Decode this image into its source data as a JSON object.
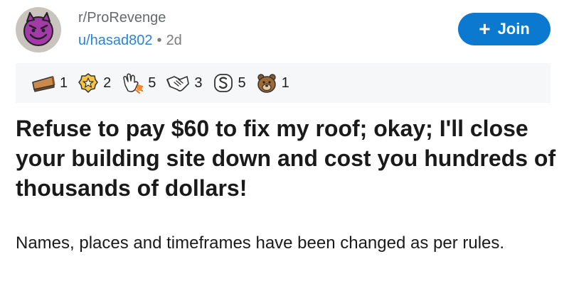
{
  "post": {
    "subreddit": "r/ProRevenge",
    "username": "u/hasad802",
    "separator": "•",
    "age": "2d",
    "join_label": "Join",
    "join_icon": "plus-icon",
    "title": "Refuse to pay $60 to fix my roof; okay; I'll close your building site down and cost you hundreds of thousands of dollars!",
    "body": "Names, places and timeframes have been changed as per rules."
  },
  "awards": [
    {
      "icon": "pie-slice-icon",
      "count": "1"
    },
    {
      "icon": "star-badge-icon",
      "count": "2"
    },
    {
      "icon": "clapping-hand-icon",
      "count": "5"
    },
    {
      "icon": "handshake-icon",
      "count": "3"
    },
    {
      "icon": "money-bag-icon",
      "count": "5"
    },
    {
      "icon": "bear-icon",
      "count": "1"
    }
  ],
  "colors": {
    "join_button": "#0b79d0",
    "username": "#2a83d6",
    "awards_bg": "#f6f7f8",
    "avatar_face": "#a33aa8"
  }
}
